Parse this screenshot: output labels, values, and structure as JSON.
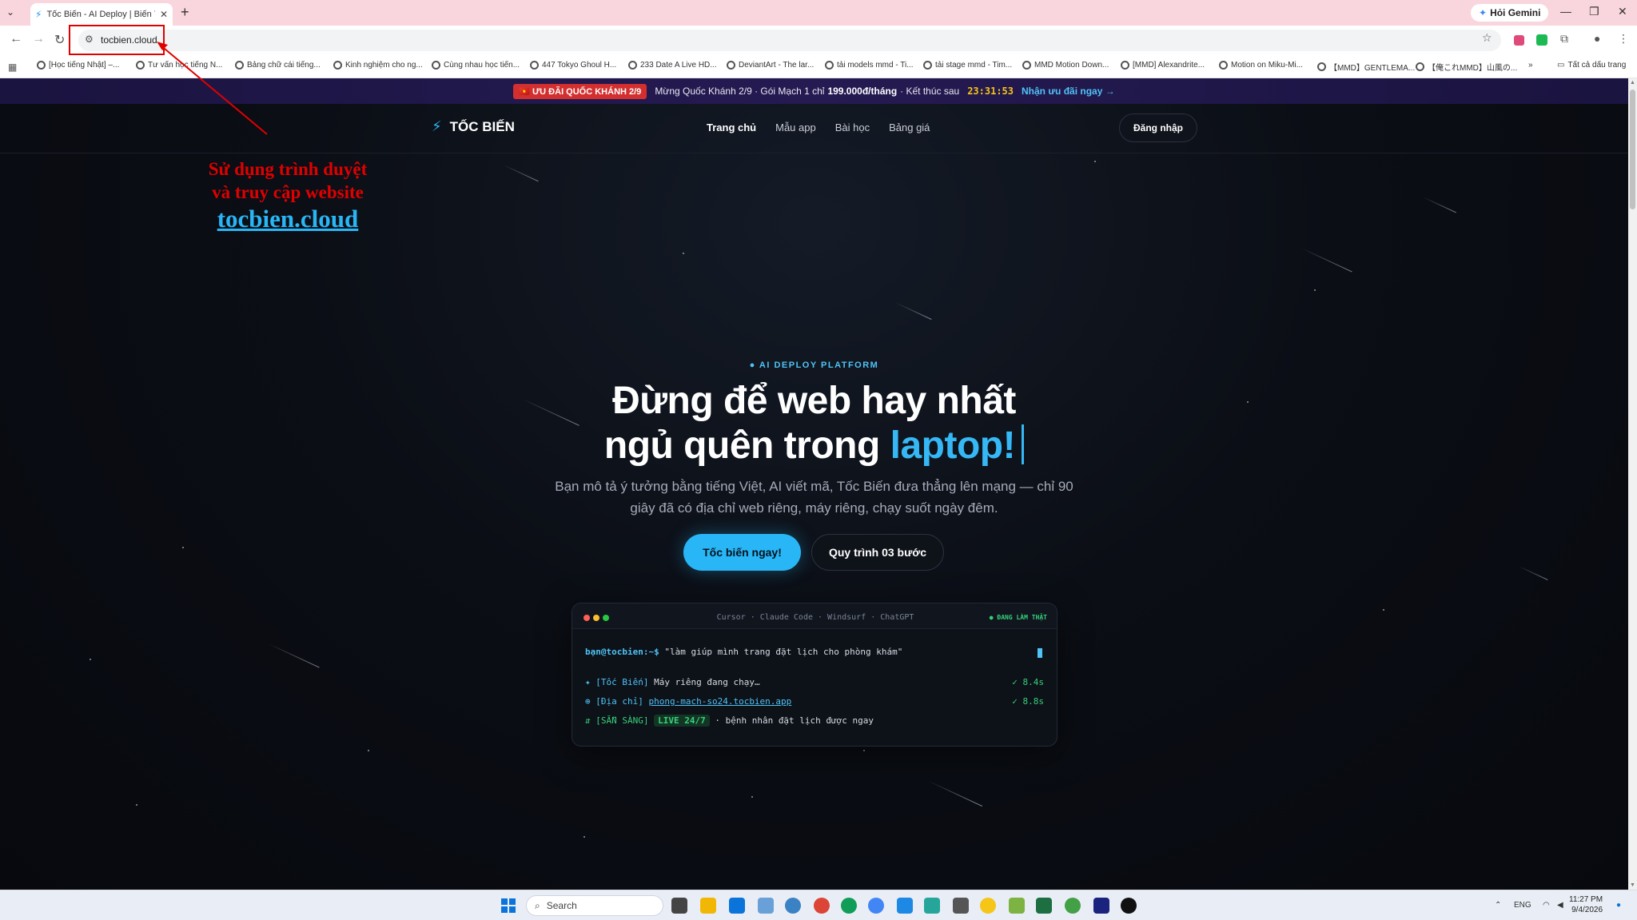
{
  "browser": {
    "tab_title": "Tốc Biến - AI Deploy | Biến Ý Tư...",
    "gemini_label": "Hỏi Gemini",
    "url": "tocbien.cloud",
    "bookmarks": [
      "[Học tiếng Nhật] –...",
      "Tư vấn học tiếng N...",
      "Bảng chữ cái tiếng...",
      "Kinh nghiệm cho ng...",
      "Cùng nhau học tiến...",
      "447 Tokyo Ghoul H...",
      "233 Date A Live HD...",
      "DeviantArt - The lar...",
      "tải models mmd - Ti...",
      "tải stage mmd - Tim...",
      "MMD Motion Down...",
      "[MMD] Alexandrite...",
      "Motion on Miku-Mi...",
      "【MMD】GENTLEMA...",
      "【俺これMMD】山風の..."
    ],
    "all_bookmarks": "Tất cả dấu trang"
  },
  "promo": {
    "badge": "🇻🇳 ƯU ĐÃI QUỐC KHÁNH 2/9",
    "text_before": "Mừng Quốc Khánh 2/9 · Gói Mạch 1 chỉ",
    "price": "199.000đ/tháng",
    "text_after": "· Kết thúc sau",
    "timer": "23:31:53",
    "cta": "Nhận ưu đãi ngay →"
  },
  "header": {
    "logo": "TỐC BIẾN",
    "nav": [
      "Trang chủ",
      "Mẫu app",
      "Bài học",
      "Bảng giá"
    ],
    "login": "Đăng nhập"
  },
  "hero": {
    "eyebrow": "● AI DEPLOY PLATFORM",
    "line1": "Đừng để web hay nhất",
    "line2_pre": "ngủ quên trong",
    "line2_accent": "laptop!",
    "subtitle": "Bạn mô tả ý tưởng bằng tiếng Việt, AI viết mã, Tốc Biến đưa thẳng lên mạng — chỉ 90 giây đã có địa chỉ web riêng, máy riêng, chạy suốt ngày đêm.",
    "primary_cta": "Tốc biến ngay!",
    "secondary_cta": "Quy trình 03 bước"
  },
  "terminal": {
    "title": "Cursor · Claude Code · Windsurf · ChatGPT",
    "status": "● ĐANG LÀM THẬT",
    "prompt": "bạn@tocbien:~$",
    "command": "\"làm giúp mình trang đặt lịch cho phòng khám\"",
    "line1_icon": "✦",
    "line1_tag": "[Tốc Biến]",
    "line1_text": "Máy riêng đang chạy…",
    "line1_time": "✓ 8.4s",
    "line2_icon": "⊕",
    "line2_tag": "[Địa chỉ]",
    "line2_link": "phong-mach-so24.tocbien.app",
    "line2_time": "✓ 8.8s",
    "line3_icon": "⇵",
    "line3_tag": "[SẴN SÀNG]",
    "line3_badge": "LIVE 24/7",
    "line3_text": "· bệnh nhân đặt lịch được ngay"
  },
  "annotation": {
    "line1": "Sử dụng trình duyệt",
    "line2": "và truy cập website",
    "url": "tocbien.cloud",
    "color": "#e00000"
  },
  "taskbar": {
    "search": "Search",
    "lang": "ENG",
    "time": "11:27 PM",
    "date": "9/4/2026"
  },
  "colors": {
    "accent": "#29b6f6",
    "background": "#0a0c12",
    "success": "#36d17a",
    "promo_badge": "#d32f2f"
  }
}
